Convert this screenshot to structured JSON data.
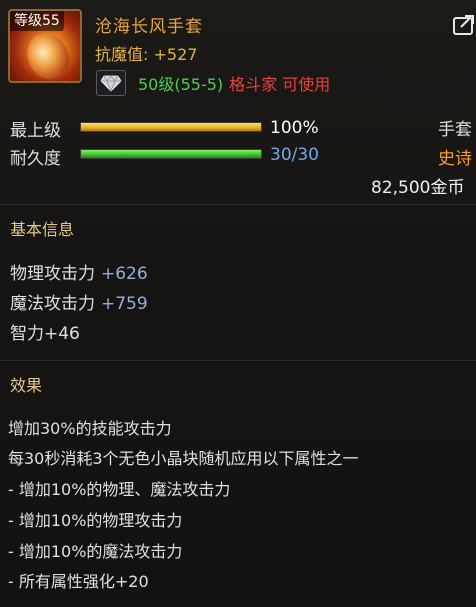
{
  "item": {
    "level_tag": "等级55",
    "name": "沧海长风手套",
    "anti_magic": "抗魔值: +527",
    "required_level": "50级(55-5)",
    "required_class": "格斗家 可使用",
    "type": "手套",
    "rarity": "史诗",
    "price": "82,500金币"
  },
  "stats": {
    "grade_label": "最上级",
    "grade_value": "100%",
    "grade_fraction": 1.0,
    "durability_label": "耐久度",
    "durability_value": "30/30",
    "durability_fraction": 1.0
  },
  "basic_info": {
    "title": "基本信息",
    "attributes": [
      {
        "label": "物理攻击力",
        "value": "+626"
      },
      {
        "label": "魔法攻击力",
        "value": "+759"
      },
      {
        "label": "智力+46",
        "value": ""
      }
    ]
  },
  "effects": {
    "title": "效果",
    "lines": [
      "增加30%的技能攻击力",
      "每30秒消耗3个无色小晶块随机应用以下属性之一",
      "- 增加10%的物理、魔法攻击力",
      "- 增加10%的物理攻击力",
      "- 增加10%的魔法攻击力",
      "- 所有属性强化+20"
    ]
  },
  "colors": {
    "name": "#e8a53c",
    "required_level": "#4cd04c",
    "required_class": "#e84040",
    "rarity": "#ff9a2a",
    "durability": "#6fa8e8"
  },
  "icons": {
    "item": "gauntlet-icon",
    "gem": "diamond-icon",
    "share": "share-icon"
  }
}
